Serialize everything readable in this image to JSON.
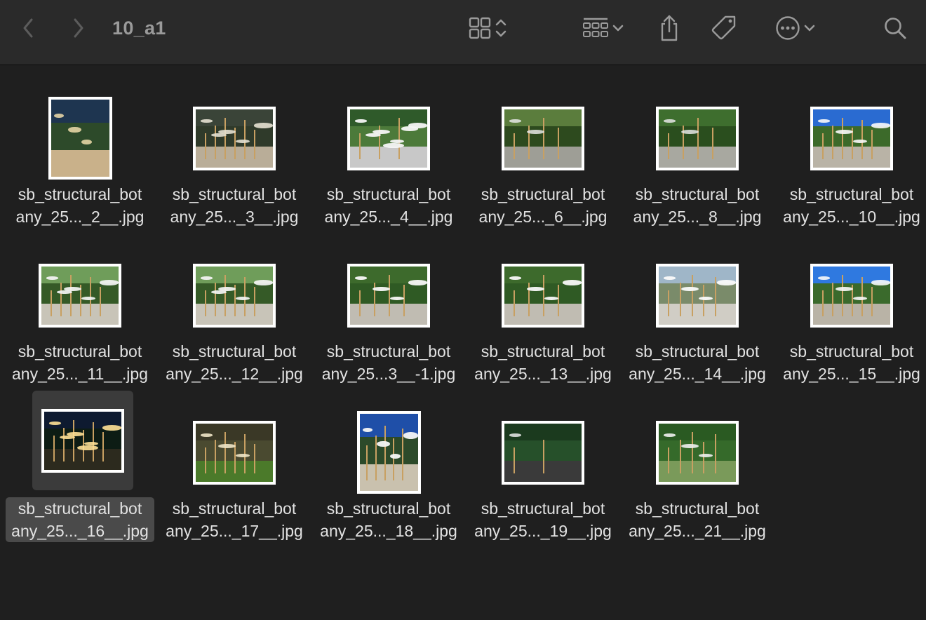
{
  "window": {
    "title": "10_a1"
  },
  "toolbar": {
    "back_icon": "chevron-left-icon",
    "forward_icon": "chevron-right-icon",
    "view_icon": "icon-grid-view-icon",
    "view_toggle_icon": "up-down-chevron-icon",
    "group_icon": "group-by-icon",
    "group_dropdown_icon": "chevron-down-icon",
    "share_icon": "share-icon",
    "tag_icon": "tag-icon",
    "more_icon": "ellipsis-circle-icon",
    "more_dropdown_icon": "chevron-down-icon",
    "search_icon": "search-icon"
  },
  "files": [
    {
      "line1": "sb_structural_bot",
      "line2": "any_25..._2__.jpg",
      "orientation": "port",
      "palette": "aerial",
      "selected": false
    },
    {
      "line1": "sb_structural_bot",
      "line2": "any_25..._3__.jpg",
      "orientation": "land",
      "palette": "dusk",
      "selected": false
    },
    {
      "line1": "sb_structural_bot",
      "line2": "any_25..._4__.jpg",
      "orientation": "land",
      "palette": "discs",
      "selected": false
    },
    {
      "line1": "sb_structural_bot",
      "line2": "any_25..._6__.jpg",
      "orientation": "land",
      "palette": "forest",
      "selected": false
    },
    {
      "line1": "sb_structural_bot",
      "line2": "any_25..._8__.jpg",
      "orientation": "land",
      "palette": "forest2",
      "selected": false
    },
    {
      "line1": "sb_structural_bot",
      "line2": "any_25..._10__.jpg",
      "orientation": "land",
      "palette": "bluesky",
      "selected": false
    },
    {
      "line1": "sb_structural_bot",
      "line2": "any_25..._11__.jpg",
      "orientation": "land",
      "palette": "day",
      "selected": false
    },
    {
      "line1": "sb_structural_bot",
      "line2": "any_25..._12__.jpg",
      "orientation": "land",
      "palette": "day",
      "selected": false
    },
    {
      "line1": "sb_structural_bot",
      "line2": "any_25...3__-1.jpg",
      "orientation": "land",
      "palette": "closeup",
      "selected": false
    },
    {
      "line1": "sb_structural_bot",
      "line2": "any_25..._13__.jpg",
      "orientation": "land",
      "palette": "closeup",
      "selected": false
    },
    {
      "line1": "sb_structural_bot",
      "line2": "any_25..._14__.jpg",
      "orientation": "land",
      "palette": "under",
      "selected": false
    },
    {
      "line1": "sb_structural_bot",
      "line2": "any_25..._15__.jpg",
      "orientation": "land",
      "palette": "bluesky2",
      "selected": false
    },
    {
      "line1": "sb_structural_bot",
      "line2": "any_25..._16__.jpg",
      "orientation": "land",
      "palette": "night",
      "selected": true
    },
    {
      "line1": "sb_structural_bot",
      "line2": "any_25..._17__.jpg",
      "orientation": "land",
      "palette": "lawn",
      "selected": false
    },
    {
      "line1": "sb_structural_bot",
      "line2": "any_25..._18__.jpg",
      "orientation": "port",
      "palette": "tall",
      "selected": false
    },
    {
      "line1": "sb_structural_bot",
      "line2": "any_25..._19__.jpg",
      "orientation": "land",
      "palette": "path",
      "selected": false
    },
    {
      "line1": "sb_structural_bot",
      "line2": "any_25..._21__.jpg",
      "orientation": "land",
      "palette": "forest3",
      "selected": false
    }
  ]
}
